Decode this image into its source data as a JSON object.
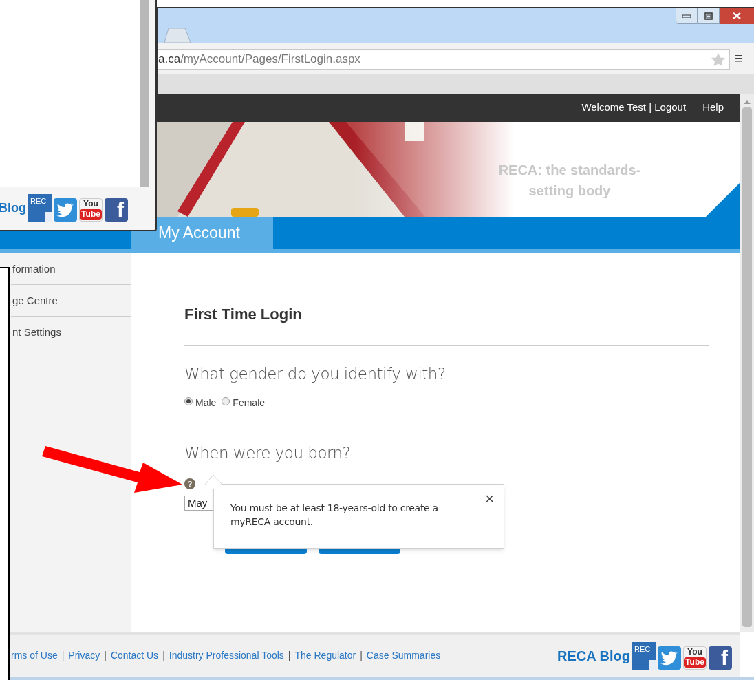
{
  "back_window": {
    "blog_link": "Blog",
    "social": [
      {
        "kind": "reca",
        "label": "REC"
      },
      {
        "kind": "twitter"
      },
      {
        "kind": "youtube",
        "label": "You",
        "label2": "Tube"
      },
      {
        "kind": "facebook",
        "label": "f"
      }
    ]
  },
  "browser": {
    "url_host": "a.ca",
    "url_path": "/myAccount/Pages/FirstLogin.aspx",
    "menu": "≡"
  },
  "top_nav": {
    "welcome": "Welcome Test | Logout",
    "help": "Help"
  },
  "banner_text": "RECA: the standards-setting body",
  "tab": {
    "label": "My Account",
    "selected": true
  },
  "sidebar": {
    "items": [
      {
        "label": "formation",
        "selected": false
      },
      {
        "label": "ge Centre",
        "selected": false
      },
      {
        "label": "nt Settings",
        "selected": false
      }
    ]
  },
  "form": {
    "title": "First Time Login",
    "gender_question": "What gender do you identify with?",
    "gender_options": [
      {
        "label": "Male",
        "selected": true
      },
      {
        "label": "Female",
        "selected": false
      }
    ],
    "birth_question": "When were you born?",
    "help": "?",
    "month": "May"
  },
  "tooltip": {
    "message": "You must be at least 18-years-old to create a myRECA account.",
    "close": "×"
  },
  "footer": {
    "separator": "|",
    "links": [
      "rms of Use",
      "Privacy",
      "Contact Us",
      "Industry Professional Tools",
      "The Regulator",
      "Case Summaries"
    ],
    "blog_link": "RECA Blog",
    "social": [
      {
        "kind": "reca",
        "label": "REC"
      },
      {
        "kind": "twitter"
      },
      {
        "kind": "youtube",
        "label": "You",
        "label2": "Tube"
      },
      {
        "kind": "facebook",
        "label": "f"
      }
    ]
  }
}
